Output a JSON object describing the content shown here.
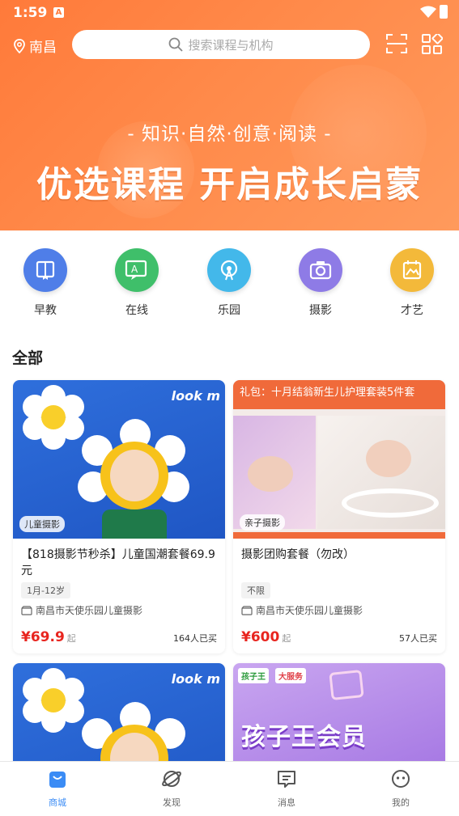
{
  "status_bar": {
    "time": "1:59",
    "notif_letter": "A"
  },
  "header": {
    "location": "南昌",
    "search_placeholder": "搜索课程与机构",
    "scan_icon": "scan-icon",
    "apps_icon": "apps-grid-icon"
  },
  "banner": {
    "line1": "- 知识·自然·创意·阅读 -",
    "line2": "优选课程  开启成长启蒙"
  },
  "categories": [
    {
      "label": "早教",
      "icon": "book-icon",
      "color": "#4f7ee8"
    },
    {
      "label": "在线",
      "icon": "online-class-icon",
      "color": "#3fbf6a"
    },
    {
      "label": "乐园",
      "icon": "ferris-wheel-icon",
      "color": "#43b8ea"
    },
    {
      "label": "摄影",
      "icon": "camera-icon",
      "color": "#8e7be6"
    },
    {
      "label": "才艺",
      "icon": "art-icon",
      "color": "#f3b93a"
    }
  ],
  "section_title": "全部",
  "products": [
    {
      "tag": "儿童摄影",
      "title": "【818摄影节秒杀】儿童国潮套餐69.9元",
      "chip": "1月-12岁",
      "store": "南昌市天使乐园儿童摄影",
      "price": "¥69.9",
      "price_suffix": "起",
      "sold": "164人已买",
      "photo_text": "look m"
    },
    {
      "tag": "亲子摄影",
      "title": "摄影团购套餐（勿改）",
      "chip": "不限",
      "store": "南昌市天使乐园儿童摄影",
      "price": "¥600",
      "price_suffix": "起",
      "sold": "57人已买",
      "photo_text": "礼包：十月结翁新生儿护理套装5件套"
    },
    {
      "photo_text": "look m"
    },
    {
      "photo_text": "孩子王会员",
      "logo1": "孩子王",
      "logo2": "大服务"
    }
  ],
  "bottom_nav": [
    {
      "label": "商城",
      "icon": "shop-bag-icon",
      "active": true
    },
    {
      "label": "发现",
      "icon": "planet-icon",
      "active": false
    },
    {
      "label": "消息",
      "icon": "message-icon",
      "active": false
    },
    {
      "label": "我的",
      "icon": "face-icon",
      "active": false
    }
  ],
  "colors": {
    "brand_orange": "#ff7a3a",
    "price_red": "#e8251f",
    "nav_active": "#3b8cf5"
  }
}
